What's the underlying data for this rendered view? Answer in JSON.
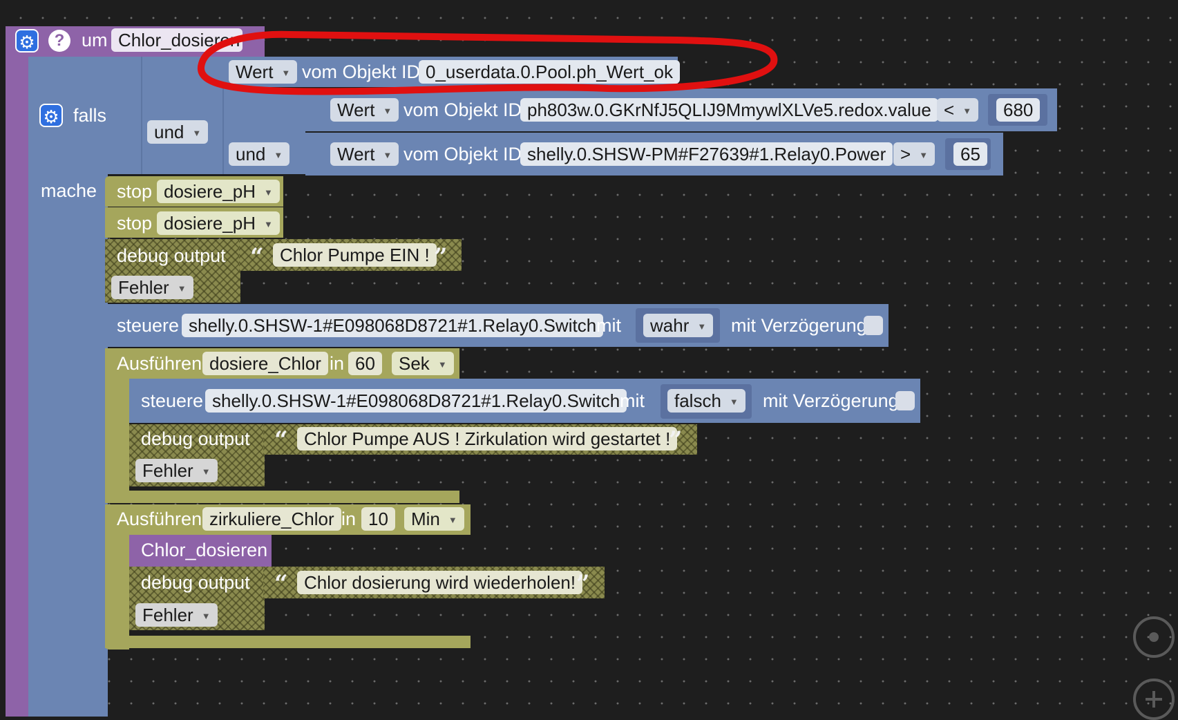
{
  "function": {
    "prefix": "um",
    "name": "Chlor_dosieren"
  },
  "condition": {
    "falls": "falls",
    "und_outer": "und",
    "und_inner": "und",
    "wert": "Wert",
    "vom_objekt_id": "vom Objekt ID",
    "row1": {
      "object_id": "0_userdata.0.Pool.ph_Wert_ok"
    },
    "row2": {
      "object_id": "ph803w.0.GKrNfJ5QLIJ9MmywlXLVe5.redox.value",
      "operator": "<",
      "value": "680"
    },
    "row3": {
      "object_id": "shelly.0.SHSW-PM#F27639#1.Relay0.Power",
      "operator": ">",
      "value": "65"
    }
  },
  "body": {
    "mache": "mache",
    "stop_label": "stop",
    "stop1_target": "dosiere_pH",
    "stop2_target": "dosiere_pH",
    "debug_label": "debug output",
    "debug1_text": "Chlor Pumpe EIN !",
    "level": "Fehler",
    "steuere_label": "steuere",
    "mit_label": "mit",
    "delay_label": "mit Verzögerung",
    "steuere1": {
      "object_id": "shelly.0.SHSW-1#E098068D8721#1.Relay0.Switch",
      "value": "wahr"
    },
    "timer_label": "Ausführen",
    "in_label": "in",
    "timer1": {
      "name": "dosiere_Chlor",
      "amount": "60",
      "unit": "Sek"
    },
    "steuere2": {
      "object_id": "shelly.0.SHSW-1#E098068D8721#1.Relay0.Switch",
      "value": "falsch"
    },
    "debug2_text": "Chlor Pumpe AUS ! Zirkulation wird gestartet !",
    "timer2": {
      "name": "zirkuliere_Chlor",
      "amount": "10",
      "unit": "Min"
    },
    "call_function": "Chlor_dosieren",
    "debug3_text": "Chlor dosierung wird wiederholen!"
  },
  "icons": {
    "gear": "gear-icon",
    "help": "help-icon",
    "quote_open": "“",
    "quote_close": "”",
    "dropdown": "▼",
    "target": "center-view-icon",
    "zoom_in": "zoom-in-icon"
  },
  "colors": {
    "function_purple": "#8e63a8",
    "logic_blue": "#6b85b3",
    "timer_olive": "#a5a65c",
    "annotation_red": "#e01010"
  }
}
